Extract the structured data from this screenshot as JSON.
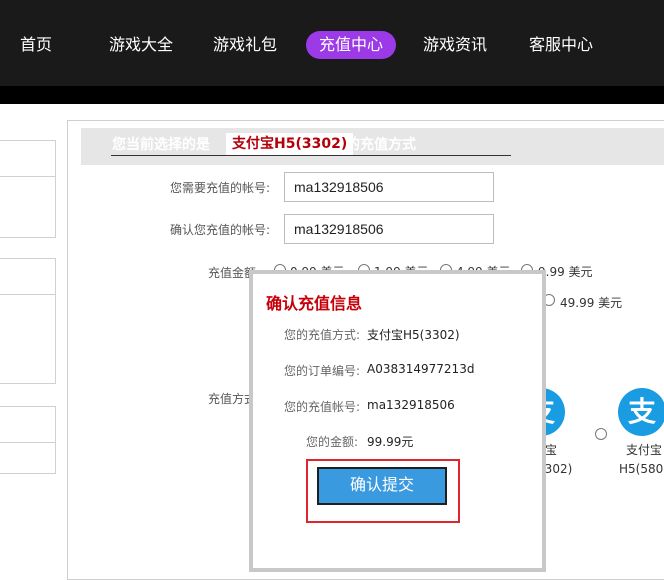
{
  "nav": {
    "items": [
      {
        "label": "首页"
      },
      {
        "label": "游戏大全"
      },
      {
        "label": "游戏礼包"
      },
      {
        "label": "充值中心",
        "active": true
      },
      {
        "label": "游戏资讯"
      },
      {
        "label": "客服中心"
      }
    ],
    "active_color": "#9c3ae8"
  },
  "panel": {
    "header_prefix": "您当前选择的是",
    "header_method": "支付宝H5(3302)",
    "header_suffix": "的充值方式",
    "account_label": "您需要充值的帐号:",
    "account_value": "ma132918506",
    "confirm_account_label": "确认您充值的帐号:",
    "confirm_account_value": "ma132918506",
    "amount_label": "充值金额:",
    "amount_options": [
      "0.99 美元",
      "1.99 美元",
      "4.99 美元",
      "9.99 美元",
      "49.99 美元"
    ],
    "method_label": "充值方式:",
    "pay_options": [
      {
        "icon": "支",
        "line1": "宝",
        "line2": "(302)"
      },
      {
        "icon": "支",
        "line1": "支付宝",
        "line2": "H5(580"
      }
    ]
  },
  "modal": {
    "title": "确认充值信息",
    "method_label": "您的充值方式:",
    "method_value": "支付宝H5(3302)",
    "order_label": "您的订单编号:",
    "order_value": "A038314977213d",
    "account_label": "您的充值帐号:",
    "account_value": "ma132918506",
    "amount_label": "您的金额:",
    "amount_value": "99.99元",
    "confirm_label": "确认提交"
  },
  "colors": {
    "brand_red": "#c8000a",
    "button_blue": "#3a9ae0",
    "highlight_red": "#e0262c",
    "alipay_blue": "#1a9ce3"
  }
}
